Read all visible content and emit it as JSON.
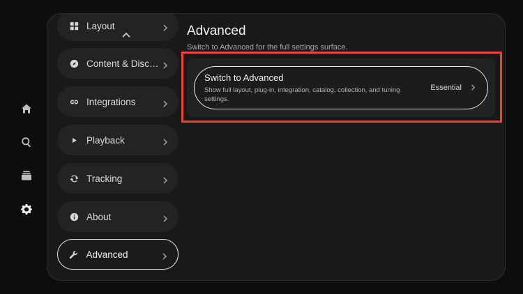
{
  "rail": {
    "items": [
      {
        "icon": "home-icon"
      },
      {
        "icon": "search-icon"
      },
      {
        "icon": "library-icon"
      },
      {
        "icon": "gear-icon"
      }
    ]
  },
  "sidebar": {
    "items": [
      {
        "label": "Layout",
        "icon": "grid-icon"
      },
      {
        "label": "Content & Discovery",
        "icon": "compass-icon"
      },
      {
        "label": "Integrations",
        "icon": "link-icon"
      },
      {
        "label": "Playback",
        "icon": "play-icon"
      },
      {
        "label": "Tracking",
        "icon": "sync-icon"
      },
      {
        "label": "About",
        "icon": "info-icon"
      },
      {
        "label": "Advanced",
        "icon": "wrench-icon"
      }
    ]
  },
  "main": {
    "title": "Advanced",
    "subtitle": "Switch to Advanced for the full settings surface.",
    "setting": {
      "title": "Switch to Advanced",
      "description": "Show full layout, plug-in, integration, catalog, collection, and tuning settings.",
      "value": "Essential"
    }
  },
  "colors": {
    "highlight": "#e8492c",
    "background": "#0d0d0d",
    "panel": "#191919"
  }
}
